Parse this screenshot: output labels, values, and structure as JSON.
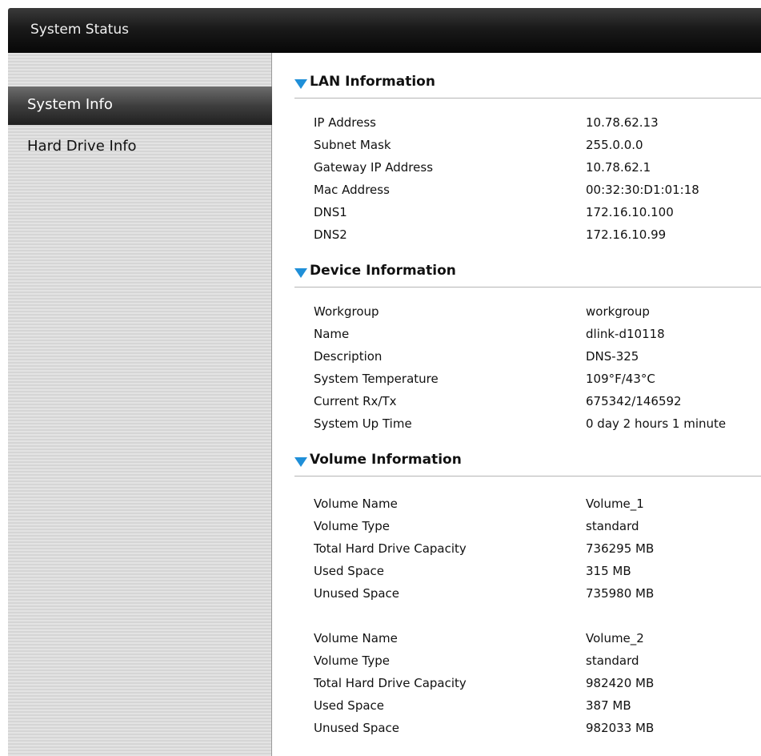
{
  "window": {
    "title": "System Status"
  },
  "sidebar": {
    "items": [
      {
        "label": "System Info",
        "active": true
      },
      {
        "label": "Hard Drive Info",
        "active": false
      }
    ]
  },
  "lan": {
    "title": "LAN Information",
    "rows": [
      {
        "label": "IP Address",
        "value": "10.78.62.13"
      },
      {
        "label": "Subnet Mask",
        "value": "255.0.0.0"
      },
      {
        "label": "Gateway IP Address",
        "value": "10.78.62.1"
      },
      {
        "label": "Mac Address",
        "value": "00:32:30:D1:01:18"
      },
      {
        "label": "DNS1",
        "value": "172.16.10.100"
      },
      {
        "label": "DNS2",
        "value": "172.16.10.99"
      }
    ]
  },
  "device": {
    "title": "Device Information",
    "rows": [
      {
        "label": "Workgroup",
        "value": "workgroup"
      },
      {
        "label": "Name",
        "value": "dlink-d10118"
      },
      {
        "label": "Description",
        "value": "DNS-325"
      },
      {
        "label": "System Temperature",
        "value": "109°F/43°C"
      },
      {
        "label": "Current Rx/Tx",
        "value": "675342/146592"
      },
      {
        "label": "System Up Time",
        "value": "0 day 2 hours 1 minute"
      }
    ]
  },
  "volume": {
    "title": "Volume Information",
    "volumes": [
      {
        "rows": [
          {
            "label": "Volume Name",
            "value": "Volume_1"
          },
          {
            "label": "Volume Type",
            "value": "standard"
          },
          {
            "label": "Total Hard Drive Capacity",
            "value": "736295 MB"
          },
          {
            "label": "Used Space",
            "value": "315 MB"
          },
          {
            "label": "Unused Space",
            "value": "735980 MB"
          }
        ]
      },
      {
        "rows": [
          {
            "label": "Volume Name",
            "value": "Volume_2"
          },
          {
            "label": "Volume Type",
            "value": "standard"
          },
          {
            "label": "Total Hard Drive Capacity",
            "value": "982420 MB"
          },
          {
            "label": "Used Space",
            "value": "387 MB"
          },
          {
            "label": "Unused Space",
            "value": "982033 MB"
          }
        ]
      }
    ]
  },
  "colors": {
    "accent_arrow": "#1f8fd8",
    "titlebar": "#0e0e0e",
    "active_item": "#3e3e3e",
    "sidebar_bg": "#dcdcdc"
  },
  "icons": {
    "section_toggle": "triangle-down-icon"
  }
}
